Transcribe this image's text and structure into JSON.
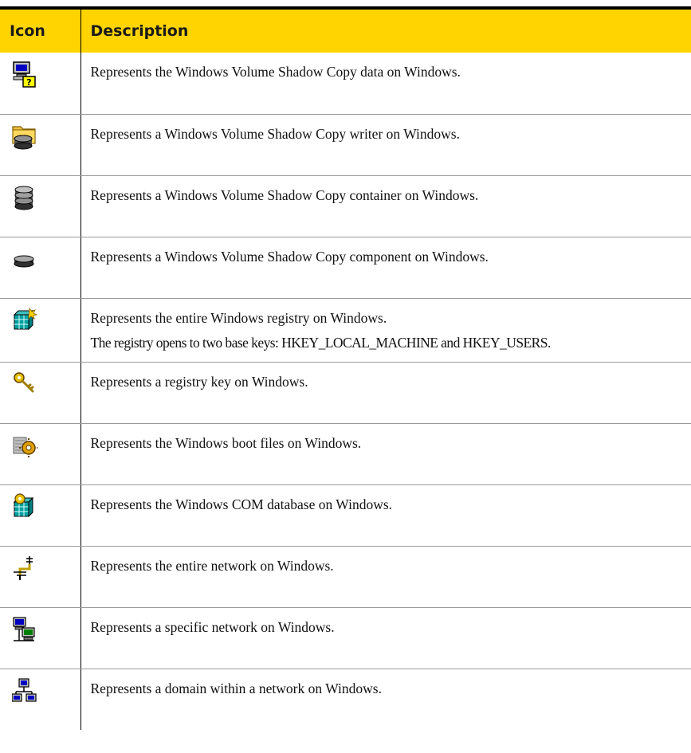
{
  "table": {
    "header": {
      "icon": "Icon",
      "description": "Description"
    },
    "rows": [
      {
        "icon": "vss-data-icon",
        "lines": [
          "Represents the Windows Volume Shadow Copy data on Windows."
        ]
      },
      {
        "icon": "vss-writer-icon",
        "lines": [
          "Represents a Windows Volume Shadow Copy writer on Windows."
        ]
      },
      {
        "icon": "vss-container-icon",
        "lines": [
          "Represents a Windows Volume Shadow Copy container on Windows."
        ]
      },
      {
        "icon": "vss-component-icon",
        "lines": [
          "Represents a Windows Volume Shadow Copy component on Windows."
        ]
      },
      {
        "icon": "registry-icon",
        "lines": [
          "Represents the entire Windows registry on Windows.",
          "The registry opens to two base keys: HKEY_LOCAL_MACHINE and HKEY_USERS."
        ]
      },
      {
        "icon": "registry-key-icon",
        "lines": [
          "Represents a registry key on Windows."
        ]
      },
      {
        "icon": "boot-files-icon",
        "lines": [
          "Represents the Windows boot files on Windows."
        ]
      },
      {
        "icon": "com-database-icon",
        "lines": [
          "Represents the Windows COM database on Windows."
        ]
      },
      {
        "icon": "entire-network-icon",
        "lines": [
          "Represents the entire network on Windows."
        ]
      },
      {
        "icon": "specific-network-icon",
        "lines": [
          "Represents a specific network on Windows."
        ]
      },
      {
        "icon": "domain-icon",
        "lines": [
          "Represents a domain within a network on Windows."
        ]
      }
    ]
  },
  "colors": {
    "header_background": "#FFD400",
    "rule": "#000000",
    "row_separator": "#9A9A9A"
  }
}
